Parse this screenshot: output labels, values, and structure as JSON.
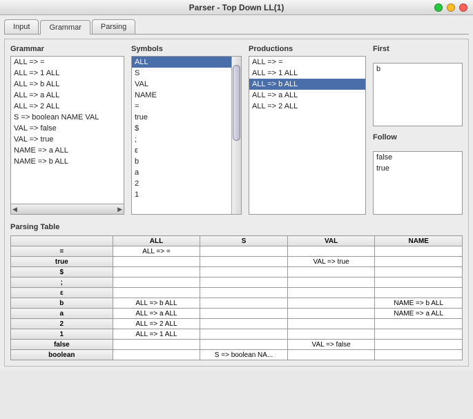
{
  "window": {
    "title": "Parser - Top Down LL(1)"
  },
  "tabs": {
    "items": [
      "Input",
      "Grammar",
      "Parsing"
    ],
    "active": 1
  },
  "grammar": {
    "title": "Grammar",
    "items": [
      "ALL => =",
      "ALL => 1 ALL",
      "ALL => b ALL",
      "ALL => a ALL",
      "ALL => 2 ALL",
      "S => boolean NAME VAL",
      "VAL => false",
      "VAL => true",
      "NAME => a ALL",
      "NAME => b ALL"
    ]
  },
  "symbols": {
    "title": "Symbols",
    "items": [
      "ALL",
      "S",
      "VAL",
      "NAME",
      "=",
      "true",
      "$",
      ";",
      "ε",
      "b",
      "a",
      "2",
      "1"
    ],
    "selected": 0
  },
  "productions": {
    "title": "Productions",
    "items": [
      "ALL => =",
      "ALL => 1 ALL",
      "ALL => b ALL",
      "ALL => a ALL",
      "ALL => 2 ALL"
    ],
    "selected": 2
  },
  "first": {
    "title": "First",
    "items": [
      "b"
    ]
  },
  "follow": {
    "title": "Follow",
    "items": [
      "false",
      "true"
    ]
  },
  "parsingTable": {
    "title": "Parsing Table",
    "columns": [
      "ALL",
      "S",
      "VAL",
      "NAME"
    ],
    "rows": [
      {
        "head": "=",
        "cells": [
          "ALL => =",
          "",
          "",
          ""
        ]
      },
      {
        "head": "true",
        "cells": [
          "",
          "",
          "VAL => true",
          ""
        ]
      },
      {
        "head": "$",
        "cells": [
          "",
          "",
          "",
          ""
        ]
      },
      {
        "head": ";",
        "cells": [
          "",
          "",
          "",
          ""
        ]
      },
      {
        "head": "ε",
        "cells": [
          "",
          "",
          "",
          ""
        ]
      },
      {
        "head": "b",
        "cells": [
          "ALL => b ALL",
          "",
          "",
          "NAME => b ALL"
        ]
      },
      {
        "head": "a",
        "cells": [
          "ALL => a ALL",
          "",
          "",
          "NAME => a ALL"
        ]
      },
      {
        "head": "2",
        "cells": [
          "ALL => 2 ALL",
          "",
          "",
          ""
        ]
      },
      {
        "head": "1",
        "cells": [
          "ALL => 1 ALL",
          "",
          "",
          ""
        ]
      },
      {
        "head": "false",
        "cells": [
          "",
          "",
          "VAL => false",
          ""
        ]
      },
      {
        "head": "boolean",
        "cells": [
          "",
          "S => boolean NA...",
          "",
          ""
        ]
      }
    ]
  }
}
